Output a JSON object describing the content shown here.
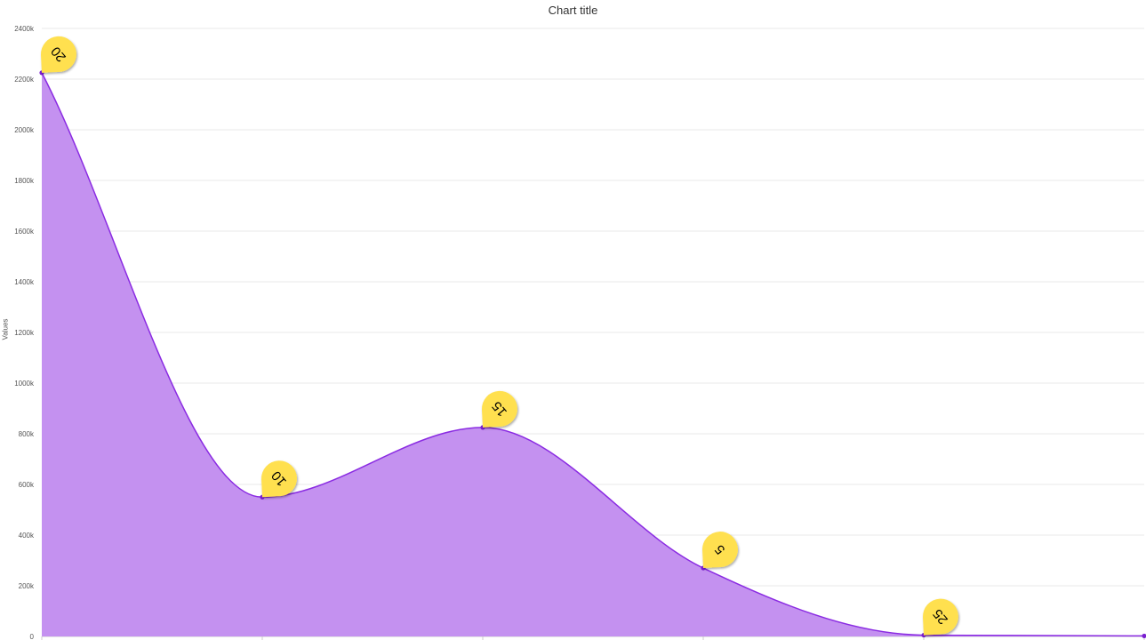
{
  "chart_data": {
    "type": "area",
    "title": "Chart title",
    "ylabel": "Values",
    "xlabel": "",
    "ylim": [
      0,
      2400000
    ],
    "y_ticks": [
      "0",
      "200k",
      "400k",
      "600k",
      "800k",
      "1000k",
      "1200k",
      "1400k",
      "1600k",
      "1800k",
      "2000k",
      "2200k",
      "2400k"
    ],
    "x": [
      0,
      1,
      2,
      3,
      4,
      5
    ],
    "series": [
      {
        "values": [
          2225000,
          550000,
          825000,
          270000,
          5000,
          2000
        ]
      }
    ],
    "point_labels": [
      "20",
      "10",
      "15",
      "5",
      "25",
      ""
    ],
    "grid": true,
    "colors": {
      "fill": "#c491f0",
      "line": "#8a2be2",
      "marker": "#7a1fd0",
      "pin": "#ffe04f",
      "grid": "#e8e8e8"
    }
  }
}
